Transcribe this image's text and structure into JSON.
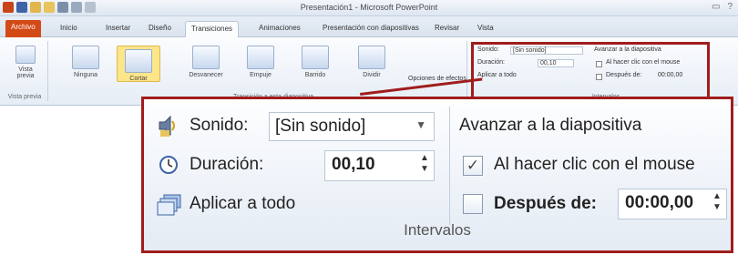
{
  "app": {
    "title": "Presentación1 - Microsoft PowerPoint",
    "window_controls": [
      "▭",
      "?"
    ]
  },
  "tabs": [
    {
      "label": "Archivo"
    },
    {
      "label": "Inicio"
    },
    {
      "label": "Insertar"
    },
    {
      "label": "Diseño"
    },
    {
      "label": "Transiciones"
    },
    {
      "label": "Animaciones"
    },
    {
      "label": "Presentación con diapositivas"
    },
    {
      "label": "Revisar"
    },
    {
      "label": "Vista"
    }
  ],
  "ribbon": {
    "preview": {
      "label_line1": "Vista",
      "label_line2": "previa",
      "group": "Vista previa"
    },
    "transitions": [
      {
        "label": "Ninguna"
      },
      {
        "label": "Cortar"
      },
      {
        "label": "Desvanecer"
      },
      {
        "label": "Empuje"
      },
      {
        "label": "Barrido"
      },
      {
        "label": "Dividir"
      }
    ],
    "effects_label": "Opciones de efectos",
    "transitions_group": "Transición a esta diapositiva",
    "small": {
      "sonido_label": "Sonido:",
      "sonido_value": "[Sin sonido]",
      "duracion_label": "Duración:",
      "duracion_value": "00,10",
      "aplicar": "Aplicar a todo",
      "avanzar": "Avanzar a la diapositiva",
      "al_hacer_clic": "Al hacer clic con el mouse",
      "despues_de": "Después de:",
      "despues_value": "00:00,00",
      "group": "Intervalos"
    }
  },
  "zoom": {
    "sonido_label": "Sonido:",
    "sonido_value": "[Sin sonido]",
    "duracion_label": "Duración:",
    "duracion_value": "00,10",
    "aplicar_label": "Aplicar a todo",
    "avanzar_label": "Avanzar a la diapositiva",
    "al_hacer_clic_label": "Al hacer clic con el mouse",
    "al_hacer_clic_checked": true,
    "despues_label": "Después de:",
    "despues_checked": false,
    "despues_value": "00:00,00",
    "group_label": "Intervalos"
  },
  "colors": {
    "highlight": "#a01d1d",
    "file_tab": "#d34a17",
    "selected_transition": "#fde58a"
  }
}
